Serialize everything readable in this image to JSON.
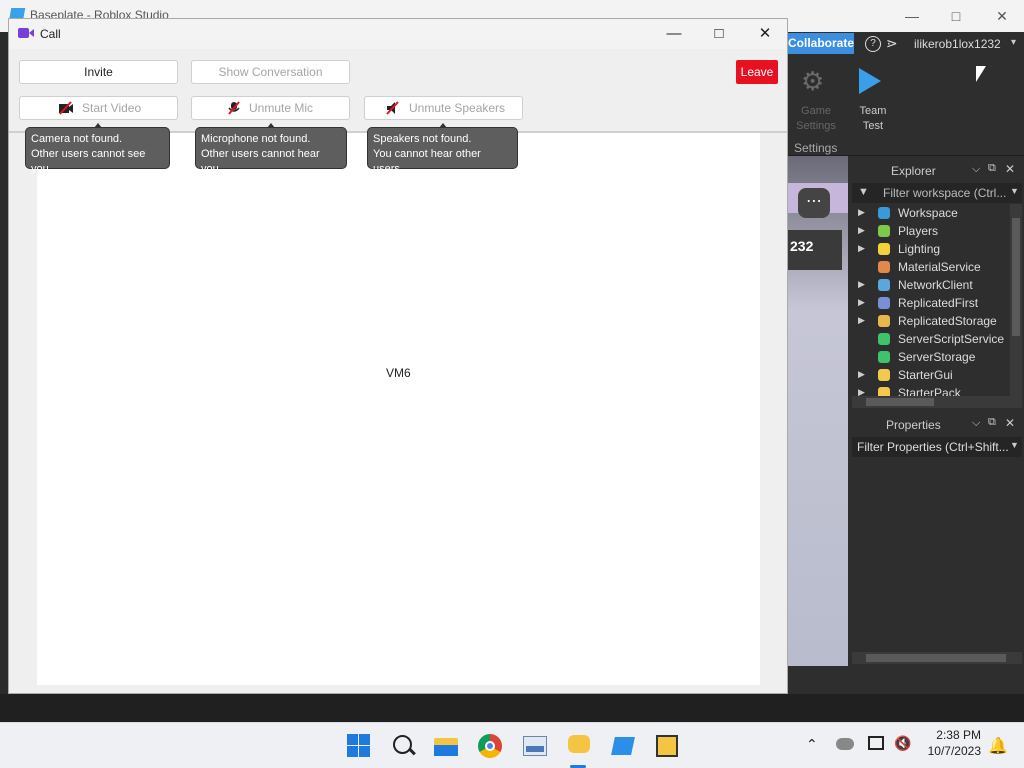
{
  "studio": {
    "title": "Baseplate - Roblox Studio",
    "collaborate_label": "Collaborate",
    "username": "ilikerob1lox1232",
    "ribbon": {
      "game_settings_label": "Game Settings",
      "team_test_label": "Team Test",
      "settings_group_label": "Settings"
    },
    "viewport_label": "232",
    "explorer": {
      "title": "Explorer",
      "filter_placeholder": "Filter workspace (Ctrl...",
      "items": [
        {
          "label": "Workspace",
          "icon": "globe-icon",
          "color": "#3a9ad9",
          "expandable": true
        },
        {
          "label": "Players",
          "icon": "players-icon",
          "color": "#7ec850",
          "expandable": true
        },
        {
          "label": "Lighting",
          "icon": "lightbulb-icon",
          "color": "#f2d33c",
          "expandable": true
        },
        {
          "label": "MaterialService",
          "icon": "material-icon",
          "color": "#e0894a",
          "expandable": false
        },
        {
          "label": "NetworkClient",
          "icon": "network-icon",
          "color": "#5aa7e0",
          "expandable": true
        },
        {
          "label": "ReplicatedFirst",
          "icon": "replicated-first-icon",
          "color": "#7a8fd6",
          "expandable": true
        },
        {
          "label": "ReplicatedStorage",
          "icon": "replicated-storage-icon",
          "color": "#e5b94a",
          "expandable": true
        },
        {
          "label": "ServerScriptService",
          "icon": "script-service-icon",
          "color": "#3ec26a",
          "expandable": false
        },
        {
          "label": "ServerStorage",
          "icon": "server-storage-icon",
          "color": "#3ec26a",
          "expandable": false
        },
        {
          "label": "StarterGui",
          "icon": "folder-icon",
          "color": "#f2c94c",
          "expandable": true
        },
        {
          "label": "StarterPack",
          "icon": "folder-icon",
          "color": "#f2c94c",
          "expandable": true
        }
      ]
    },
    "properties": {
      "title": "Properties",
      "filter_placeholder": "Filter Properties (Ctrl+Shift..."
    }
  },
  "call": {
    "title": "Call",
    "buttons": {
      "invite": "Invite",
      "show_conversation": "Show Conversation",
      "leave": "Leave",
      "start_video": "Start Video",
      "unmute_mic": "Unmute Mic",
      "unmute_speakers": "Unmute Speakers"
    },
    "tooltips": {
      "camera": [
        "Camera not found.",
        "Other users cannot see you."
      ],
      "mic": [
        "Microphone not found.",
        "Other users cannot hear you."
      ],
      "speakers": [
        "Speakers not found.",
        "You cannot hear other users."
      ]
    },
    "participant_label": "VM6",
    "accent_color": "#7a3fd8",
    "leave_color": "#e81123"
  },
  "taskbar": {
    "apps": [
      "windows-start-icon",
      "search-icon",
      "file-explorer-icon",
      "chrome-icon",
      "photos-icon",
      "chat-app-icon",
      "roblox-studio-icon",
      "roblox-player-icon"
    ],
    "time": "2:38 PM",
    "date": "10/7/2023"
  }
}
